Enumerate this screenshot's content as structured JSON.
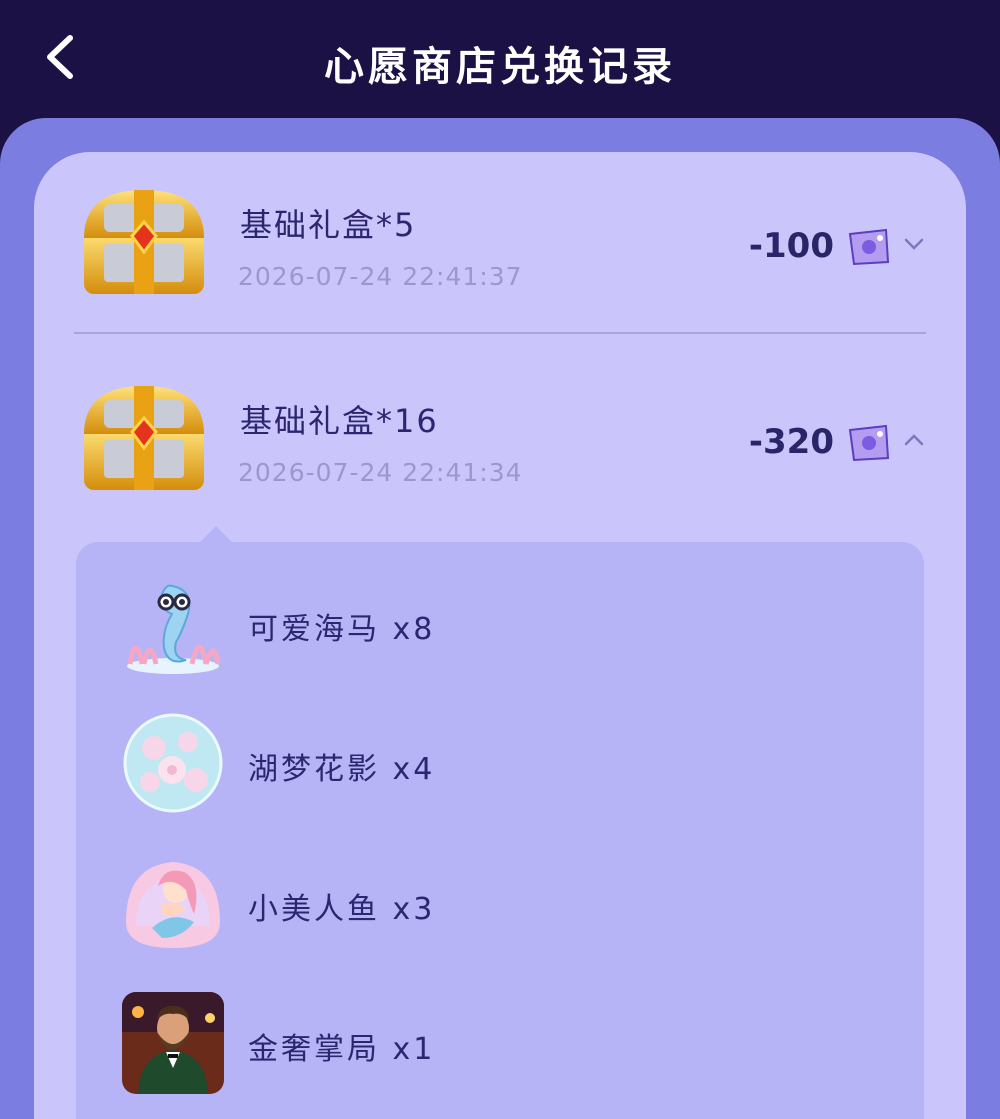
{
  "header": {
    "title": "心愿商店兑换记录",
    "back_icon": "chevron-left-icon"
  },
  "records": [
    {
      "name": "基础礼盒*5",
      "time": "2026-07-24 22:41:37",
      "amount": "-100",
      "icon": "treasure-chest-icon",
      "currency_icon": "purple-ticket-icon",
      "expanded": false
    },
    {
      "name": "基础礼盒*16",
      "time": "2026-07-24 22:41:34",
      "amount": "-320",
      "icon": "treasure-chest-icon",
      "currency_icon": "purple-ticket-icon",
      "expanded": true,
      "items": [
        {
          "label": "可爱海马 x8",
          "image": "seahorse-image"
        },
        {
          "label": "湖梦花影 x4",
          "image": "flower-bubble-image"
        },
        {
          "label": "小美人鱼 x3",
          "image": "mermaid-image"
        },
        {
          "label": "金奢掌局 x1",
          "image": "gentleman-image"
        }
      ]
    }
  ],
  "colors": {
    "topbar": "#1b1145",
    "page_bg": "#7b7de0",
    "card_bg": "#cac6fb",
    "detail_bg": "#b6b4f6",
    "text_dark": "#2c2670",
    "text_muted": "#9c98cc",
    "chest_gold": "#f3b51c"
  }
}
